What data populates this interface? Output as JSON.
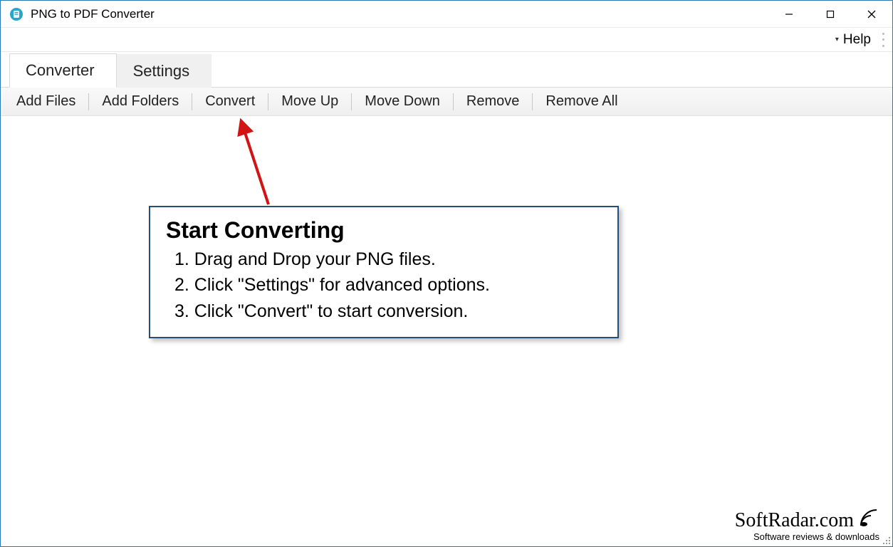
{
  "window": {
    "title": "PNG to PDF Converter"
  },
  "menu": {
    "help": "Help"
  },
  "tabs": {
    "converter": "Converter",
    "settings": "Settings"
  },
  "toolbar": {
    "add_files": "Add Files",
    "add_folders": "Add Folders",
    "convert": "Convert",
    "move_up": "Move Up",
    "move_down": "Move Down",
    "remove": "Remove",
    "remove_all": "Remove All"
  },
  "info": {
    "heading": "Start Converting",
    "step1": "1. Drag and Drop your PNG files.",
    "step2": "2. Click \"Settings\" for advanced options.",
    "step3": "3. Click \"Convert\" to start conversion."
  },
  "watermark": {
    "brand": "SoftRadar.com",
    "tagline": "Software reviews & downloads"
  }
}
